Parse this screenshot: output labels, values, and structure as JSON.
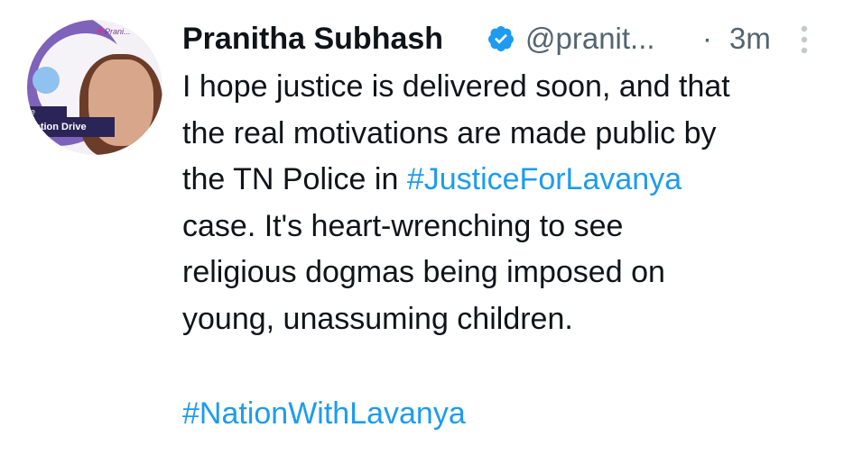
{
  "author": {
    "display_name": "Pranitha Subhash",
    "handle": "@pranit...",
    "verified_icon": "verified-badge-icon",
    "timestamp_separator": "·",
    "timestamp": "3m",
    "avatar": {
      "logo_text": "Prani...",
      "banner_text": "nation Drive",
      "banner_top_text": "e"
    }
  },
  "tweet": {
    "lines": [
      {
        "text": "I hope justice is delivered soon, and that"
      },
      {
        "text": "the real motivations are made public by"
      },
      {
        "prefix": "the TN Police in ",
        "hashtag": "#JusticeForLavanya"
      },
      {
        "text": "case. It's heart-wrenching to see"
      },
      {
        "text": "religious dogmas being imposed on"
      },
      {
        "text": "young, unassuming children."
      }
    ],
    "final_hashtag": "#NationWithLavanya"
  },
  "colors": {
    "text": "#0f1419",
    "secondary": "#536471",
    "link": "#1d9bf0",
    "verified": "#1d9bf0"
  }
}
